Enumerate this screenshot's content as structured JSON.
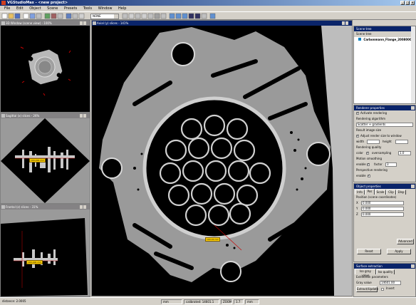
{
  "window": {
    "title": "VGStudioMax - <new project>"
  },
  "menu": [
    "File",
    "Edit",
    "Object",
    "Scene",
    "Presets",
    "Tools",
    "Window",
    "Help"
  ],
  "toolbar": {
    "combo_value": "NONE"
  },
  "panels": {
    "view3d": {
      "title": "3D Window (scene view) - 100%"
    },
    "sagittal": {
      "title": "Sagittal (x) slices - 26%"
    },
    "frontal": {
      "title": "Frontal (z) slices - 31%"
    },
    "axial": {
      "title": "Axial (y) slices - 141%"
    }
  },
  "annotations": {
    "sag_marker": "100.000 mm",
    "front_marker": "100.000 mm",
    "axial_marker": "100.00 mm"
  },
  "scene_tree": {
    "title": "Scene tree",
    "root": "Scene tree",
    "item": "Carbonmann_Flange_20080001"
  },
  "render_props": {
    "title": "Renderer properties",
    "activate": "Activate rendering",
    "algo_label": "Rendering algorithm",
    "algo_value": "Scatter + gradients",
    "image_size_label": "Result image size",
    "adjust": "Adjust render size to window",
    "width_label": "width",
    "height_label": "height",
    "quality_label": "Rendering quality",
    "color_label": "color",
    "oversampling_label": "oversampling",
    "oversampling_value": "1.0",
    "motion_label": "Motion smoothing",
    "enable_label": "enable",
    "factor_label": "factor",
    "factor_value": "3",
    "persp_label": "Perspective rendering",
    "persp_enable": "enable"
  },
  "object_props": {
    "title": "Object properties",
    "tabs": [
      "Info",
      "Pos",
      "Scale",
      "Clip",
      "Disp"
    ],
    "position_label": "Position (scene coordinates)",
    "x_label": "X",
    "x_value": "0.000",
    "y_label": "Y",
    "y_value": "0.000",
    "z_label": "Z",
    "z_value": "0.000",
    "advanced": "Advanced",
    "reset": "Reset",
    "apply": "Apply"
  },
  "surface": {
    "title": "Surface extraction",
    "tabs": [
      "Iso gray value",
      "Iso quality"
    ],
    "params_label": "Extraction parameters",
    "gray_label": "Gray value",
    "gray_value": "14601.00",
    "btn_label": "Extract/Update",
    "invert_label": "Invert"
  },
  "status": {
    "distance": "distance: 2.0005",
    "units": "mm",
    "calibrated": "calibrated: 14601.1",
    "zoom_label": "ZOOM",
    "zoom_value": "1.7",
    "units2": "mm"
  },
  "colors": {
    "title_active": "#0a246a",
    "title_inactive": "#848284",
    "face": "#d4d0c8",
    "marker": "#ffd000"
  }
}
